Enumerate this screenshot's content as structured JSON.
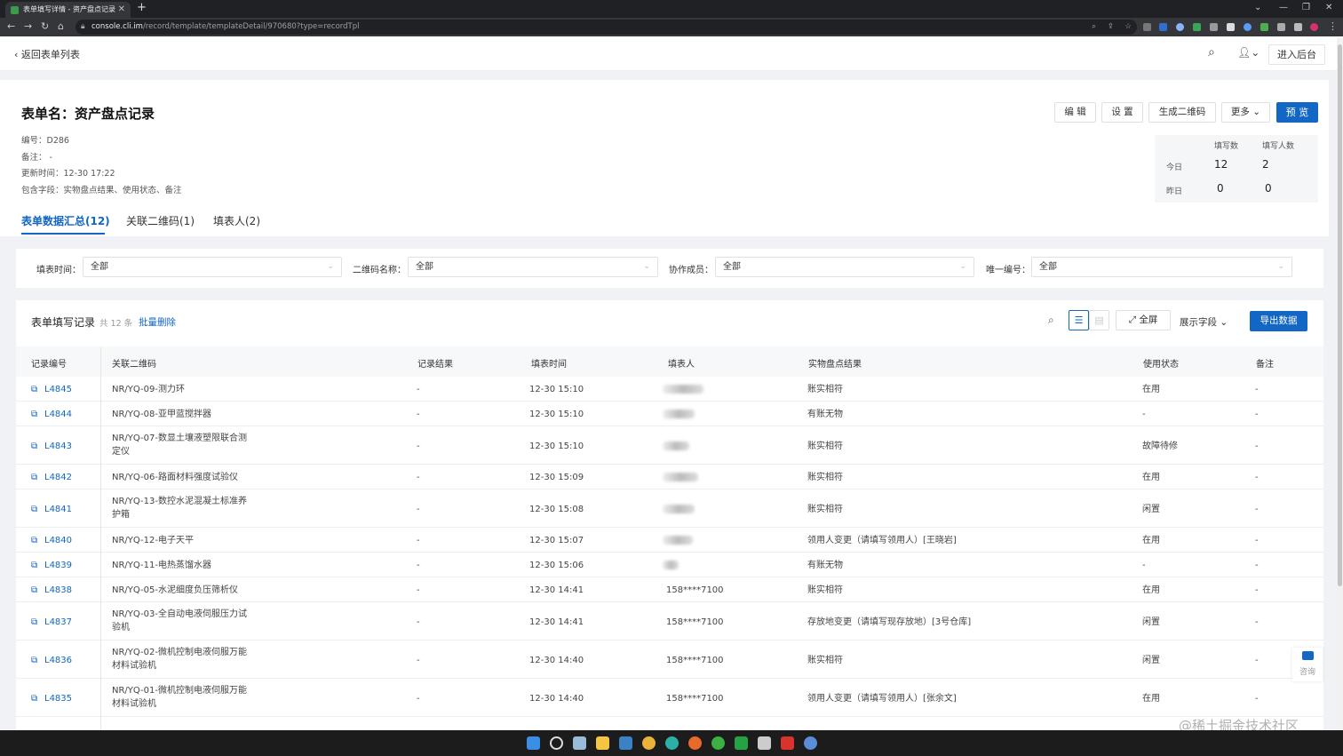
{
  "browser": {
    "tab_title": "表单填写详情 - 资产盘点记录",
    "url_host": "console.cli.im",
    "url_path": "/record/template/templateDetail/970680?type=recordTpl"
  },
  "header": {
    "back_label": "返回表单列表",
    "enter_admin": "进入后台"
  },
  "form": {
    "title": "表单名：资产盘点记录",
    "code": "编号：D286",
    "remark": "备注： -",
    "updated": "更新时间：12-30 17:22",
    "fields": "包含字段：实物盘点结果、使用状态、备注",
    "buttons": {
      "edit": "编 辑",
      "settings": "设 置",
      "qrcode": "生成二维码",
      "more": "更多",
      "preview": "预 览"
    }
  },
  "stats": {
    "col_fills": "填写数",
    "col_people": "填写人数",
    "rows": [
      {
        "label": "今日",
        "fills": "12",
        "people": "2"
      },
      {
        "label": "昨日",
        "fills": "0",
        "people": "0"
      }
    ]
  },
  "tabs": [
    "表单数据汇总(12)",
    "关联二维码(1)",
    "填表人(2)"
  ],
  "filters": [
    {
      "label": "填表时间：",
      "value": "全部"
    },
    {
      "label": "二维码名称：",
      "value": "全部"
    },
    {
      "label": "协作成员：",
      "value": "全部"
    },
    {
      "label": "唯一编号：",
      "value": "全部"
    }
  ],
  "table": {
    "title": "表单填写记录",
    "count": "共 12 条",
    "batch_delete": "批量删除",
    "fullscreen": "全屏",
    "display_fields": "展示字段",
    "export": "导出数据",
    "columns": [
      "记录编号",
      "关联二维码",
      "记录结果",
      "填表时间",
      "填表人",
      "实物盘点结果",
      "使用状态",
      "备注"
    ],
    "rows": [
      {
        "id": "L4845",
        "qr": [
          "NR/YQ-09-测力环"
        ],
        "result": "-",
        "time": "12-30 15:10",
        "user": "",
        "check": "账实相符",
        "status": "在用",
        "note": "-"
      },
      {
        "id": "L4844",
        "qr": [
          "NR/YQ-08-亚甲蓝搅拌器"
        ],
        "result": "-",
        "time": "12-30 15:10",
        "user": "",
        "check": "有账无物",
        "status": "-",
        "note": "-"
      },
      {
        "id": "L4843",
        "qr": [
          "NR/YQ-07-数显土壤液塑限联合测",
          "定仪"
        ],
        "result": "-",
        "time": "12-30 15:10",
        "user": "",
        "check": "账实相符",
        "status": "故障待修",
        "note": "-"
      },
      {
        "id": "L4842",
        "qr": [
          "NR/YQ-06-路面材料强度试验仪"
        ],
        "result": "-",
        "time": "12-30 15:09",
        "user": "",
        "check": "账实相符",
        "status": "在用",
        "note": "-"
      },
      {
        "id": "L4841",
        "qr": [
          "NR/YQ-13-数控水泥混凝土标准养",
          "护箱"
        ],
        "result": "-",
        "time": "12-30 15:08",
        "user": "",
        "check": "账实相符",
        "status": "闲置",
        "note": "-"
      },
      {
        "id": "L4840",
        "qr": [
          "NR/YQ-12-电子天平"
        ],
        "result": "-",
        "time": "12-30 15:07",
        "user": "",
        "check": "领用人变更（请填写领用人）[王晓岩]",
        "status": "在用",
        "note": "-"
      },
      {
        "id": "L4839",
        "qr": [
          "NR/YQ-11-电热蒸馏水器"
        ],
        "result": "-",
        "time": "12-30 15:06",
        "user": "",
        "check": "有账无物",
        "status": "-",
        "note": "-"
      },
      {
        "id": "L4838",
        "qr": [
          "NR/YQ-05-水泥细度负压筛析仪"
        ],
        "result": "-",
        "time": "12-30 14:41",
        "user": "158****7100",
        "check": "账实相符",
        "status": "在用",
        "note": "-"
      },
      {
        "id": "L4837",
        "qr": [
          "NR/YQ-03-全自动电液伺服压力试",
          "验机"
        ],
        "result": "-",
        "time": "12-30 14:41",
        "user": "158****7100",
        "check": "存放地变更（请填写现存放地）[3号仓库]",
        "status": "闲置",
        "note": "-"
      },
      {
        "id": "L4836",
        "qr": [
          "NR/YQ-02-微机控制电液伺服万能",
          "材料试验机"
        ],
        "result": "-",
        "time": "12-30 14:40",
        "user": "158****7100",
        "check": "账实相符",
        "status": "闲置",
        "note": "-"
      },
      {
        "id": "L4835",
        "qr": [
          "NR/YQ-01-微机控制电液伺服万能",
          "材料试验机"
        ],
        "result": "-",
        "time": "12-30 14:40",
        "user": "158****7100",
        "check": "领用人变更（请填写领用人）[张余文]",
        "status": "在用",
        "note": "-"
      }
    ]
  },
  "consult": "咨询",
  "watermark": "@稀土掘金技术社区"
}
